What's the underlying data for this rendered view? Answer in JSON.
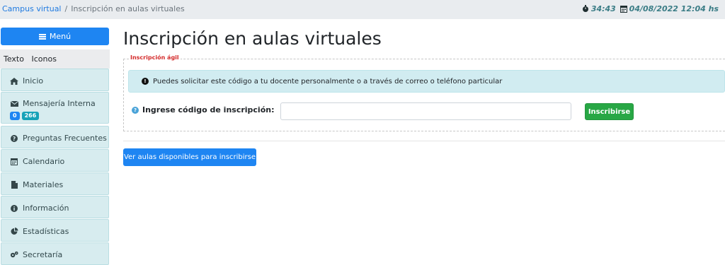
{
  "breadcrumb": {
    "root": "Campus virtual",
    "separator": "/",
    "current": "Inscripción en aulas virtuales"
  },
  "status": {
    "timer": "34:43",
    "datetime": "04/08/2022 12:04 hs"
  },
  "sidebar": {
    "menu_label": "Menú",
    "view_modes": [
      "Texto",
      "Iconos"
    ],
    "items": [
      {
        "label": "Inicio",
        "icon": "home-icon"
      },
      {
        "label": "Mensajería Interna",
        "icon": "envelope-icon",
        "badges": [
          "0",
          "266"
        ]
      },
      {
        "label": "Preguntas Frecuentes",
        "icon": "question-circle-icon"
      },
      {
        "label": "Calendario",
        "icon": "calendar-icon"
      },
      {
        "label": "Materiales",
        "icon": "file-icon"
      },
      {
        "label": "Información",
        "icon": "info-circle-icon"
      },
      {
        "label": "Estadísticas",
        "icon": "pie-chart-icon"
      },
      {
        "label": "Secretaría",
        "icon": "gears-icon"
      }
    ]
  },
  "main": {
    "title": "Inscripción en aulas virtuales",
    "fieldset_legend": "Inscripción ágil",
    "info_text": "Puedes solicitar este código a tu docente personalmente o a través de correo o teléfono particular",
    "code_label": "Ingrese código de inscripción:",
    "code_value": "",
    "enroll_button": "Inscribirse",
    "view_rooms_button": "Ver aulas disponibles para inscribirse"
  },
  "colors": {
    "primary": "#1e85f2",
    "success": "#28a745",
    "alert_bg": "#d1ecf1",
    "sidebar_item_bg": "#d7ecef",
    "legend": "#d42b2b",
    "timer": "#3b7d86"
  }
}
